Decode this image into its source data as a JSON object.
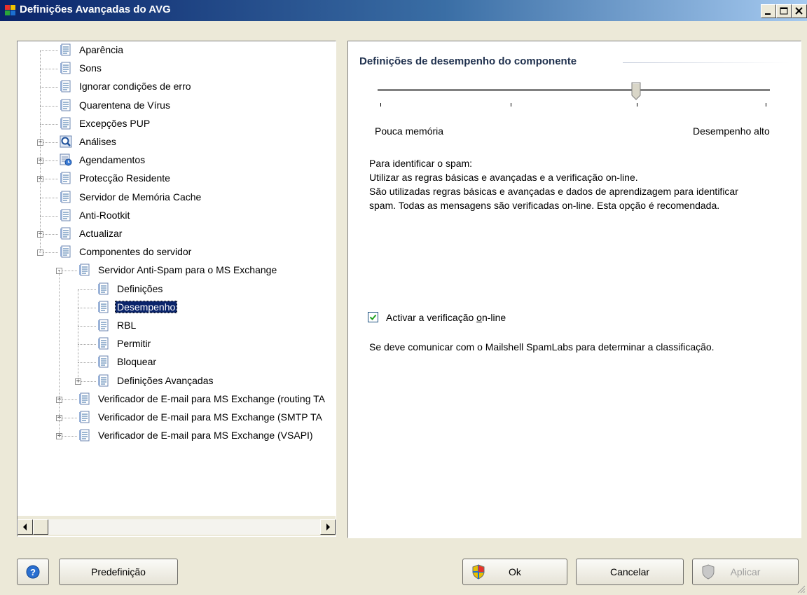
{
  "window": {
    "title": "Definições Avançadas do AVG",
    "buttons": [
      "minimize",
      "maximize",
      "close"
    ]
  },
  "tree": {
    "items": [
      {
        "label": "Aparência",
        "level": 0,
        "icon": "settings-doc-icon",
        "expander": null
      },
      {
        "label": "Sons",
        "level": 0,
        "icon": "settings-doc-icon",
        "expander": null
      },
      {
        "label": "Ignorar condições de erro",
        "level": 0,
        "icon": "settings-doc-icon",
        "expander": null
      },
      {
        "label": "Quarentena de Vírus",
        "level": 0,
        "icon": "settings-doc-icon",
        "expander": null
      },
      {
        "label": "Excepções PUP",
        "level": 0,
        "icon": "settings-doc-icon",
        "expander": null
      },
      {
        "label": "Análises",
        "level": 0,
        "icon": "magnifier-icon",
        "expander": "+"
      },
      {
        "label": "Agendamentos",
        "level": 0,
        "icon": "scheduler-icon",
        "expander": "+"
      },
      {
        "label": "Protecção Residente",
        "level": 0,
        "icon": "settings-doc-icon",
        "expander": "+"
      },
      {
        "label": "Servidor de Memória Cache",
        "level": 0,
        "icon": "settings-doc-icon",
        "expander": null
      },
      {
        "label": "Anti-Rootkit",
        "level": 0,
        "icon": "settings-doc-icon",
        "expander": null
      },
      {
        "label": "Actualizar",
        "level": 0,
        "icon": "settings-doc-icon",
        "expander": "+"
      },
      {
        "label": "Componentes do servidor",
        "level": 0,
        "icon": "settings-doc-icon",
        "expander": "-"
      },
      {
        "label": "Servidor Anti-Spam para o MS Exchange",
        "level": 1,
        "icon": "settings-doc-icon",
        "expander": "-"
      },
      {
        "label": "Definições",
        "level": 2,
        "icon": "settings-doc-icon",
        "expander": null
      },
      {
        "label": "Desempenho",
        "level": 2,
        "icon": "settings-doc-icon",
        "expander": null,
        "selected": true
      },
      {
        "label": "RBL",
        "level": 2,
        "icon": "settings-doc-icon",
        "expander": null
      },
      {
        "label": "Permitir",
        "level": 2,
        "icon": "settings-doc-icon",
        "expander": null
      },
      {
        "label": "Bloquear",
        "level": 2,
        "icon": "settings-doc-icon",
        "expander": null
      },
      {
        "label": "Definições Avançadas",
        "level": 2,
        "icon": "settings-doc-icon",
        "expander": "+"
      },
      {
        "label": "Verificador de E-mail para MS Exchange (routing TA",
        "level": 1,
        "icon": "settings-doc-icon",
        "expander": "+"
      },
      {
        "label": "Verificador de E-mail para MS Exchange (SMTP TA",
        "level": 1,
        "icon": "settings-doc-icon",
        "expander": "+"
      },
      {
        "label": "Verificador de E-mail para MS Exchange (VSAPI)",
        "level": 1,
        "icon": "settings-doc-icon",
        "expander": "+"
      }
    ]
  },
  "panel": {
    "title": "Definições de desempenho do componente",
    "slider": {
      "low_label": "Pouca memória",
      "high_label": "Desempenho alto",
      "position": 0.67,
      "tick_count": 4
    },
    "description": [
      "Para identificar o spam:",
      "Utilizar as regras básicas e avançadas e a verificação on-line.",
      "São utilizadas regras básicas e avançadas e dados de aprendizagem para identificar",
      "spam. Todas as mensagens são verificadas on-line. Esta opção é recomendada."
    ],
    "checkbox": {
      "label_before": "Activar a verificação ",
      "label_accel": "o",
      "label_after": "n-line",
      "checked": true
    },
    "info": "Se deve comunicar com o Mailshell SpamLabs para determinar a classificação."
  },
  "footer": {
    "help_icon": "help-icon",
    "default_label": "Predefinição",
    "ok_label": "Ok",
    "cancel_label": "Cancelar",
    "apply_label": "Aplicar"
  },
  "colors": {
    "selection": "#0a246a",
    "title_gradient_start": "#0a246a",
    "title_gradient_end": "#a6caf0",
    "panel_title": "#21324f"
  }
}
